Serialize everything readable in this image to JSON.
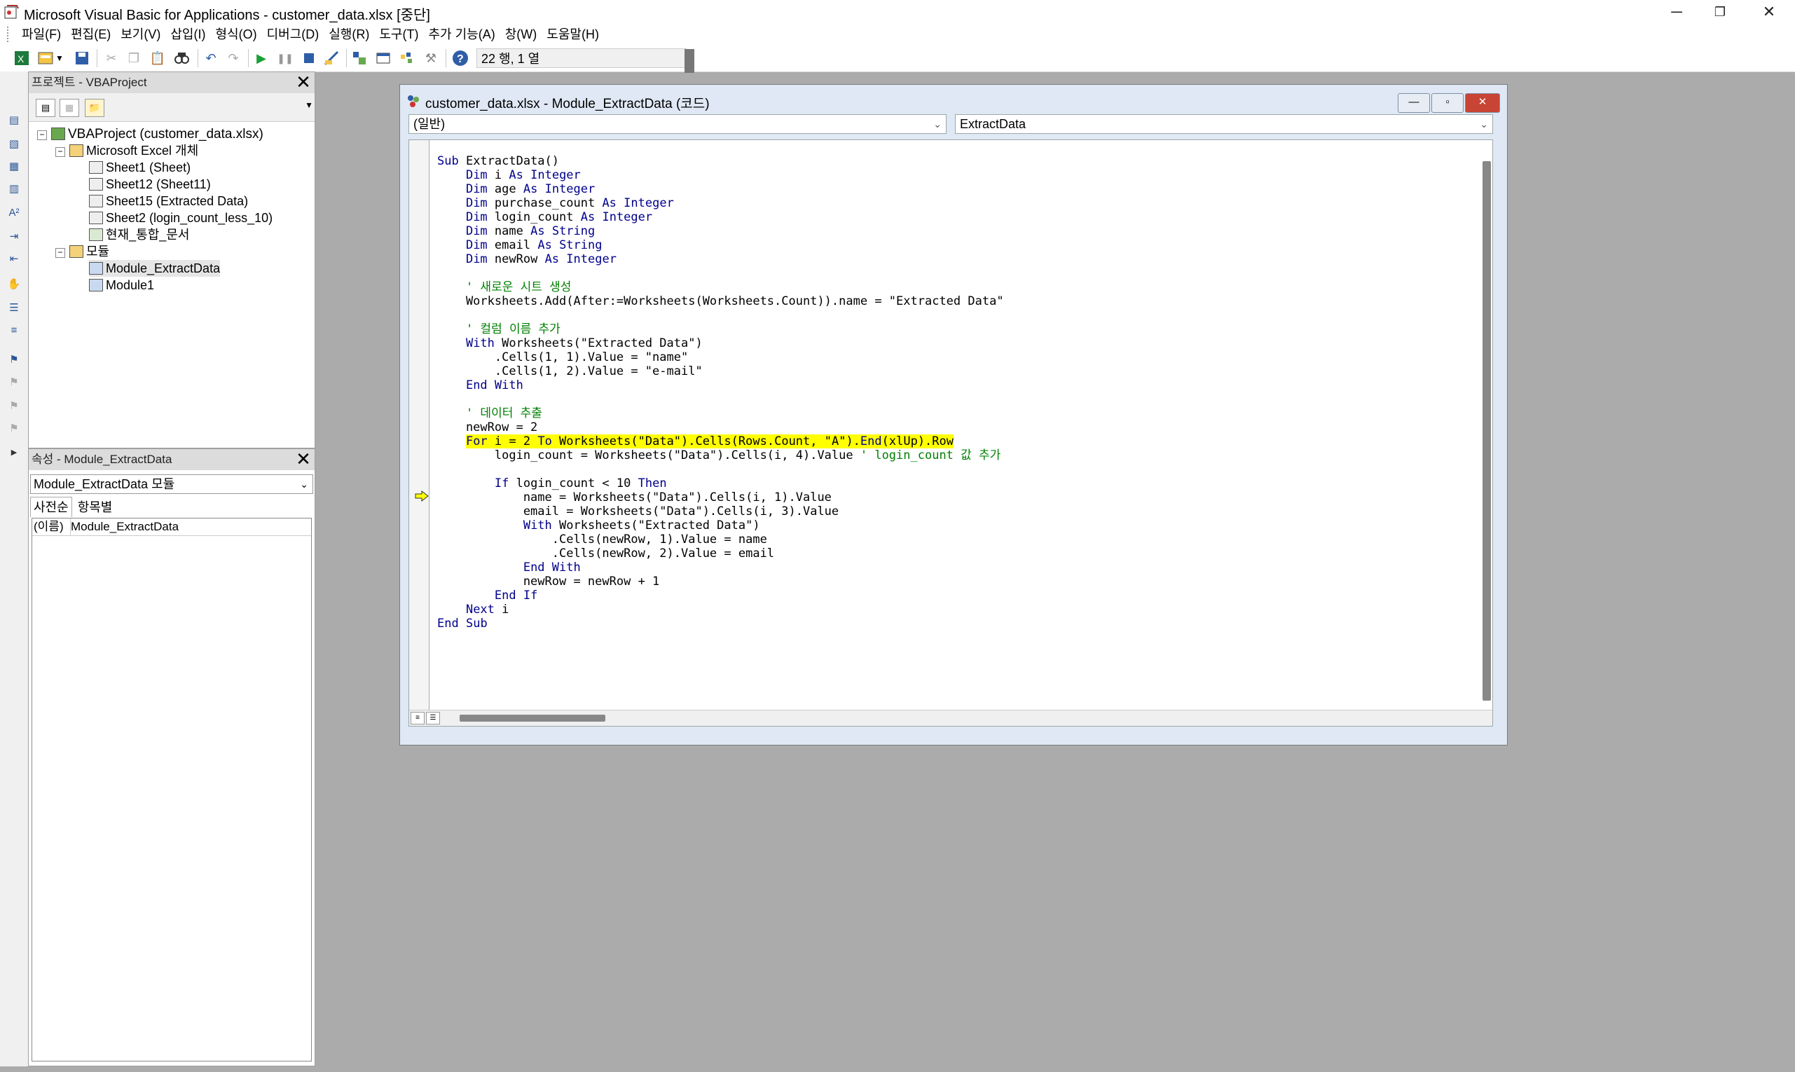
{
  "window": {
    "title": "Microsoft Visual Basic for Applications - customer_data.xlsx [중단]",
    "minimize": "─",
    "restore": "❐",
    "close": "✕"
  },
  "menu": [
    "파일(F)",
    "편집(E)",
    "보기(V)",
    "삽입(I)",
    "형식(O)",
    "디버그(D)",
    "실행(R)",
    "도구(T)",
    "추가 기능(A)",
    "창(W)",
    "도움말(H)"
  ],
  "toolbar": {
    "position": "22 행, 1 열"
  },
  "project": {
    "title": "프로젝트 - VBAProject",
    "close": "✕",
    "root": "VBAProject (customer_data.xlsx)",
    "excel_objects": "Microsoft Excel 개체",
    "sheets": [
      "Sheet1 (Sheet)",
      "Sheet12 (Sheet11)",
      "Sheet15 (Extracted Data)",
      "Sheet2 (login_count_less_10)",
      "현재_통합_문서"
    ],
    "modules_folder": "모듈",
    "modules": [
      "Module_ExtractData",
      "Module1"
    ]
  },
  "properties": {
    "title": "속성 - Module_ExtractData",
    "close": "✕",
    "object": "Module_ExtractData 모듈",
    "tabs": [
      "사전순",
      "항목별"
    ],
    "rows": [
      {
        "name": "(이름)",
        "value": "Module_ExtractData"
      }
    ]
  },
  "code_window": {
    "title": "customer_data.xlsx - Module_ExtractData (코드)",
    "object_combo": "(일반)",
    "procedure_combo": "ExtractData",
    "minimize": "—",
    "restore": "▫",
    "close": "✕",
    "highlight_line": 20,
    "lines": [
      "Sub ExtractData()",
      "    Dim i As Integer",
      "    Dim age As Integer",
      "    Dim purchase_count As Integer",
      "    Dim login_count As Integer",
      "    Dim name As String",
      "    Dim email As String",
      "    Dim newRow As Integer",
      "",
      "    ' 새로운 시트 생성",
      "    Worksheets.Add(After:=Worksheets(Worksheets.Count)).name = \"Extracted Data\"",
      "",
      "    ' 컬럼 이름 추가",
      "    With Worksheets(\"Extracted Data\")",
      "        .Cells(1, 1).Value = \"name\"",
      "        .Cells(1, 2).Value = \"e-mail\"",
      "    End With",
      "",
      "    ' 데이터 추출",
      "    newRow = 2",
      "    For i = 2 To Worksheets(\"Data\").Cells(Rows.Count, \"A\").End(xlUp).Row",
      "        login_count = Worksheets(\"Data\").Cells(i, 4).Value ' login_count 값 추가",
      "",
      "        If login_count < 10 Then",
      "            name = Worksheets(\"Data\").Cells(i, 1).Value",
      "            email = Worksheets(\"Data\").Cells(i, 3).Value",
      "            With Worksheets(\"Extracted Data\")",
      "                .Cells(newRow, 1).Value = name",
      "                .Cells(newRow, 2).Value = email",
      "            End With",
      "            newRow = newRow + 1",
      "        End If",
      "    Next i",
      "End Sub"
    ]
  }
}
